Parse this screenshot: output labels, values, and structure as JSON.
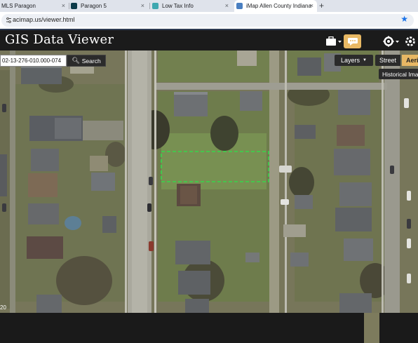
{
  "browser": {
    "tabs": [
      {
        "label": "MLS Paragon",
        "favicon_color": "#ffffff",
        "active": false
      },
      {
        "label": "Paragon 5",
        "favicon_color": "#0d3b49",
        "active": false
      },
      {
        "label": "Low Tax Info",
        "favicon_color": "#3fa8b0",
        "active": false
      },
      {
        "label": "iMap Allen County Indiana",
        "favicon_color": "#4a7fc1",
        "active": true
      }
    ],
    "close_glyph": "×",
    "new_tab_glyph": "+",
    "url": "acimap.us/viewer.html",
    "bookmark_icon": "star-icon"
  },
  "app": {
    "title": "GIS Data Viewer",
    "header_buttons": [
      {
        "name": "briefcase-icon",
        "has_caret": true
      },
      {
        "name": "chat-icon",
        "active": true
      },
      {
        "name": "map-icon"
      },
      {
        "name": "tools-icon",
        "has_caret": true
      },
      {
        "name": "settings-icon"
      }
    ],
    "accent_color": "#e8b864"
  },
  "map": {
    "search": {
      "value": "02-13-276-010.000-074",
      "button_label": "Search"
    },
    "layers_label": "Layers",
    "basemaps": {
      "street": "Street",
      "aerial": "Aerial"
    },
    "historical_label": "Historical Imagery",
    "zoom_label": "20",
    "selection_color": "#37d64b"
  }
}
